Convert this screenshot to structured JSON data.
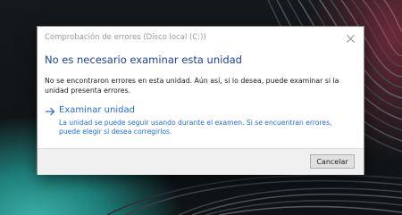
{
  "dialog": {
    "title": "Comprobación de errores (Disco local (C:))",
    "close_icon": "close-icon",
    "heading": "No es necesario examinar esta unidad",
    "description": "No se encontraron errores en esta unidad. Aún así, si lo desea, puede examinar si la unidad presenta errores.",
    "command_link": {
      "icon": "arrow-right-icon",
      "title": "Examinar unidad",
      "description": "La unidad se puede seguir usando durante el examen. Si se encuentran errores, puede elegir si desea corregirlos."
    },
    "cancel_label": "Cancelar"
  },
  "colors": {
    "heading": "#1b3fa8",
    "link": "#1e6dd6",
    "footer": "#f0f0f0"
  }
}
